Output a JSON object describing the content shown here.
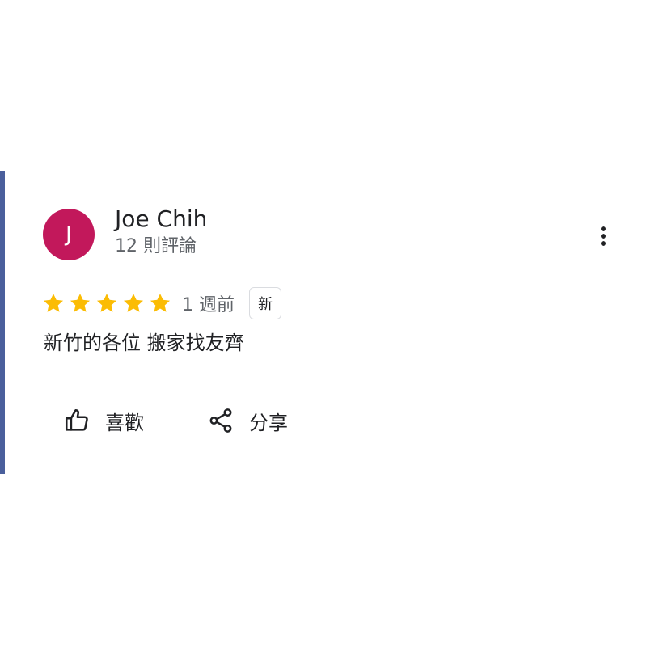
{
  "review": {
    "avatar_letter": "J",
    "avatar_color": "#c2185b",
    "reviewer_name": "Joe Chih",
    "review_count": "12 則評論",
    "rating": 5,
    "rating_max": 5,
    "star_color": "#fbbc04",
    "time": "1 週前",
    "new_badge": "新",
    "text": "新竹的各位 搬家找友齊",
    "more_icon": "more-vert-icon"
  },
  "actions": {
    "like_label": "喜歡",
    "like_icon": "thumb-up-icon",
    "share_label": "分享",
    "share_icon": "share-icon"
  }
}
